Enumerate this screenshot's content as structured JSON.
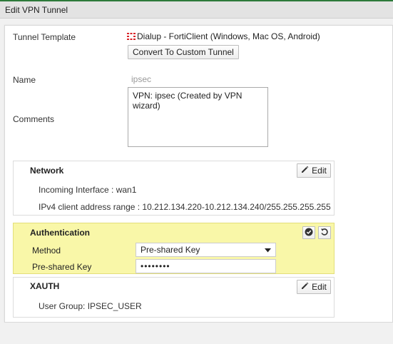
{
  "header": {
    "title": "Edit VPN Tunnel"
  },
  "form": {
    "tunnel_template_label": "Tunnel Template",
    "tunnel_template_value": "Dialup - FortiClient (Windows, Mac OS, Android)",
    "convert_button": "Convert To Custom Tunnel",
    "name_label": "Name",
    "name_value": "ipsec",
    "comments_label": "Comments",
    "comments_value": "VPN: ipsec (Created by VPN wizard)"
  },
  "network": {
    "title": "Network",
    "edit_label": "Edit",
    "incoming_interface": "Incoming Interface : wan1",
    "ipv4_range": "IPv4 client address range : 10.212.134.220-10.212.134.240/255.255.255.255"
  },
  "authentication": {
    "title": "Authentication",
    "method_label": "Method",
    "method_value": "Pre-shared Key",
    "psk_label": "Pre-shared Key",
    "psk_value": "••••••••"
  },
  "xauth": {
    "title": "XAUTH",
    "edit_label": "Edit",
    "user_group": "User Group: IPSEC_USER"
  },
  "colors": {
    "accent_line": "#2d7a3a",
    "auth_bg": "#f9f7a8",
    "fortinet_red": "#d9252a"
  },
  "icons": [
    "fortinet-logo-icon",
    "pencil-icon",
    "check-circle-icon",
    "undo-icon",
    "caret-down-icon"
  ]
}
